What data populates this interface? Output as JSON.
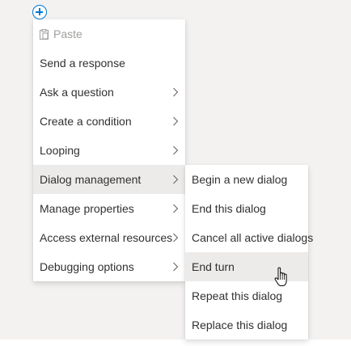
{
  "main_menu": {
    "paste_label": "Paste",
    "items": [
      {
        "label": "Send a response"
      },
      {
        "label": "Ask a question"
      },
      {
        "label": "Create a condition"
      },
      {
        "label": "Looping"
      },
      {
        "label": "Dialog management"
      },
      {
        "label": "Manage properties"
      },
      {
        "label": "Access external resources"
      },
      {
        "label": "Debugging options"
      }
    ]
  },
  "submenu": {
    "items": [
      {
        "label": "Begin a new dialog"
      },
      {
        "label": "End this dialog"
      },
      {
        "label": "Cancel all active dialogs"
      },
      {
        "label": "End turn"
      },
      {
        "label": "Repeat this dialog"
      },
      {
        "label": "Replace this dialog"
      }
    ]
  },
  "icons": {
    "add": "add-circle-icon",
    "paste": "paste-icon",
    "chevron": "chevron-right-icon",
    "cursor": "hand-pointer-icon"
  },
  "colors": {
    "accent": "#0078d4",
    "menu_bg": "#ffffff",
    "hover_bg": "#edebe9",
    "canvas_bg": "#f3f2f1",
    "disabled_text": "#a19f9d",
    "text": "#323130"
  }
}
